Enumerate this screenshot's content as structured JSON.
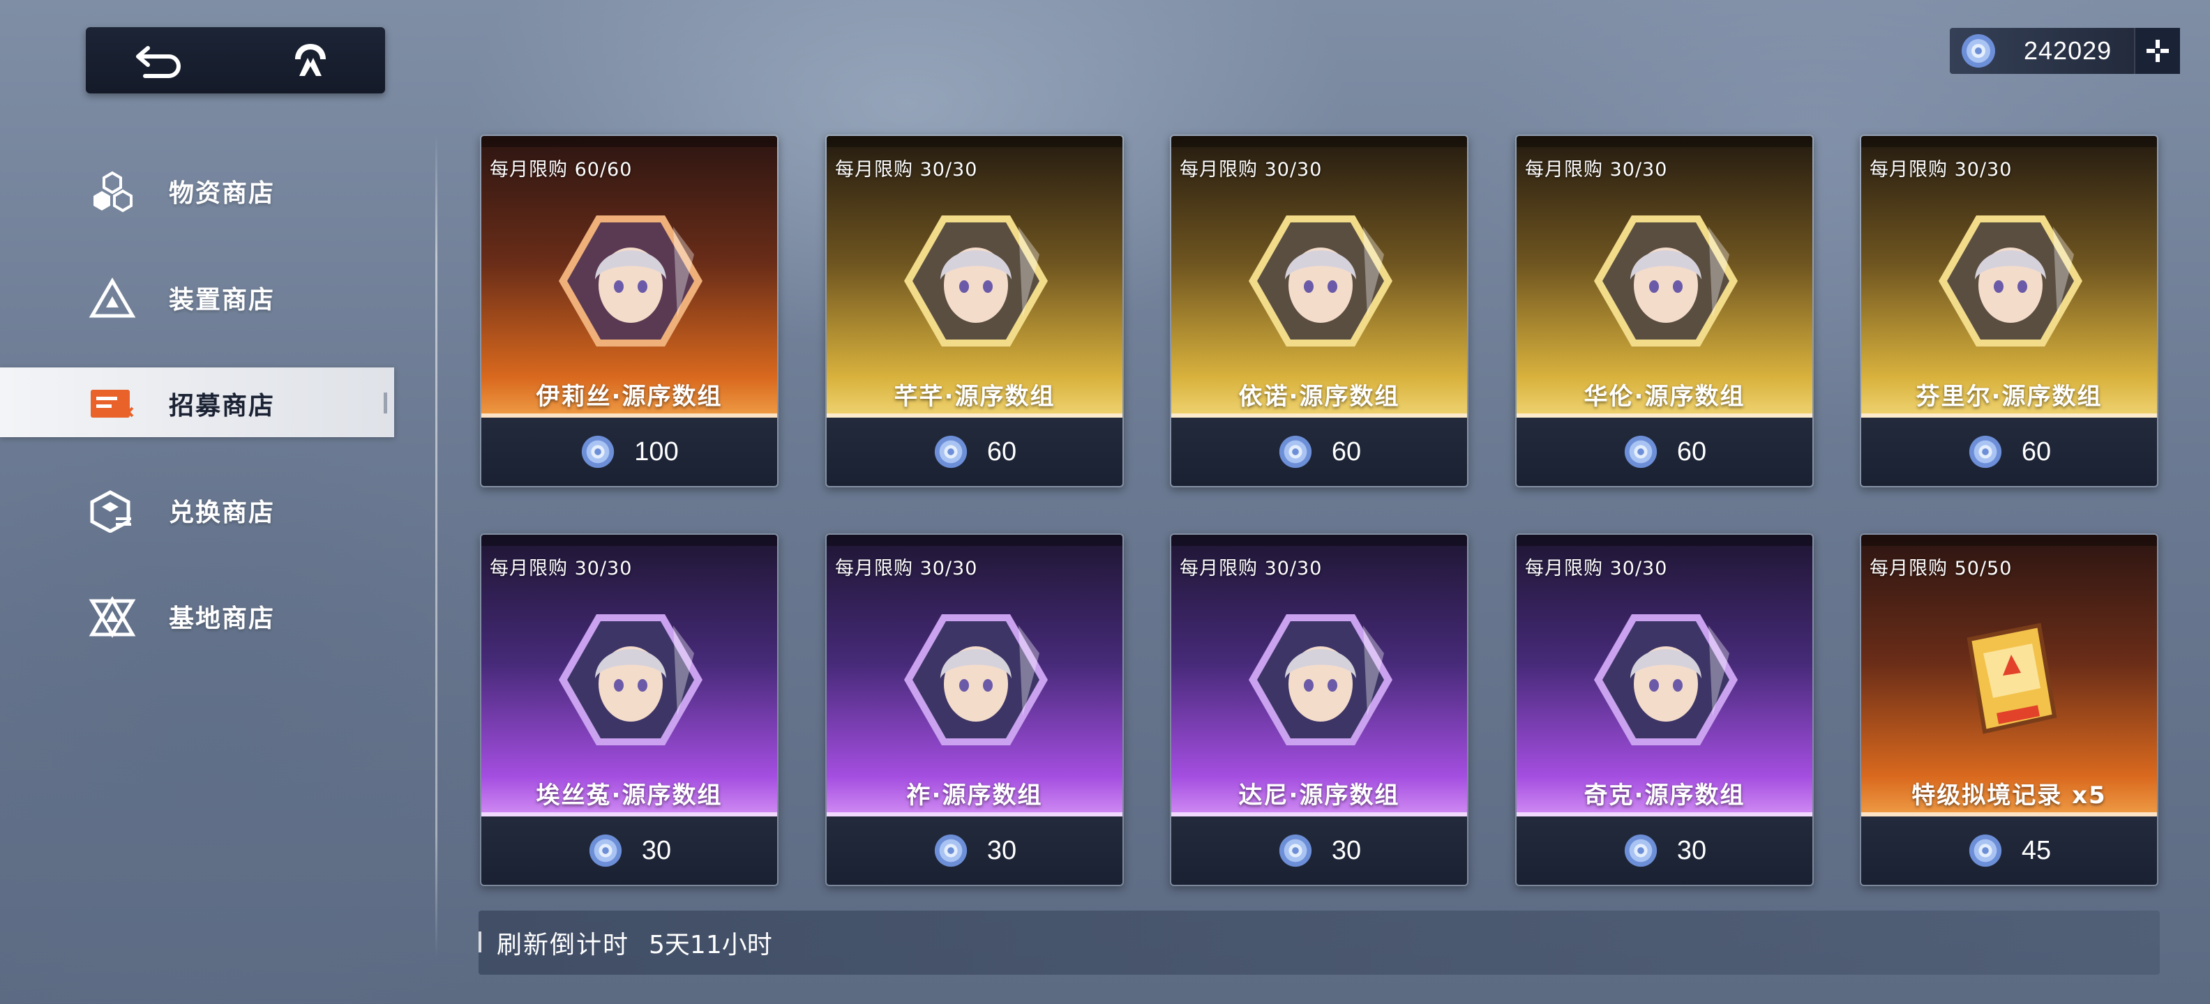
{
  "nav": {
    "back_icon": "back-arrow-icon",
    "home_icon": "home-emblem-icon"
  },
  "currency": {
    "icon": "crystal-coin-icon",
    "amount": "242029",
    "add_icon": "plus-icon"
  },
  "sidebar": {
    "items": [
      {
        "label": "物资商店",
        "icon": "supply-hexagons-icon",
        "active": false
      },
      {
        "label": "装置商店",
        "icon": "device-triangle-icon",
        "active": false
      },
      {
        "label": "招募商店",
        "icon": "recruit-ticket-icon",
        "active": true
      },
      {
        "label": "兑换商店",
        "icon": "exchange-cube-icon",
        "active": false
      },
      {
        "label": "基地商店",
        "icon": "base-emblem-icon",
        "active": false
      }
    ]
  },
  "cards": [
    {
      "limit": "每月限购  60/60",
      "name": "伊莉丝·源序数组",
      "price": "100",
      "theme": "orange"
    },
    {
      "limit": "每月限购  30/30",
      "name": "芊芊·源序数组",
      "price": "60",
      "theme": "gold"
    },
    {
      "limit": "每月限购  30/30",
      "name": "依诺·源序数组",
      "price": "60",
      "theme": "gold"
    },
    {
      "limit": "每月限购  30/30",
      "name": "华伦·源序数组",
      "price": "60",
      "theme": "gold"
    },
    {
      "limit": "每月限购  30/30",
      "name": "芬里尔·源序数组",
      "price": "60",
      "theme": "gold"
    },
    {
      "limit": "每月限购  30/30",
      "name": "埃丝菟·源序数组",
      "price": "30",
      "theme": "purple"
    },
    {
      "limit": "每月限购  30/30",
      "name": "祚·源序数组",
      "price": "30",
      "theme": "purple"
    },
    {
      "limit": "每月限购  30/30",
      "name": "达尼·源序数组",
      "price": "30",
      "theme": "purple"
    },
    {
      "limit": "每月限购  30/30",
      "name": "奇克·源序数组",
      "price": "30",
      "theme": "purple"
    },
    {
      "limit": "每月限购  50/50",
      "name": "特级拟境记录 x5",
      "price": "45",
      "theme": "orange"
    }
  ],
  "refresh": {
    "label": "刷新倒计时",
    "value": "5天11小时"
  },
  "colors": {
    "orange": "#d9691e",
    "gold": "#d9b23d",
    "purple": "#a44ee0",
    "panel_dark": "#1a2132"
  }
}
